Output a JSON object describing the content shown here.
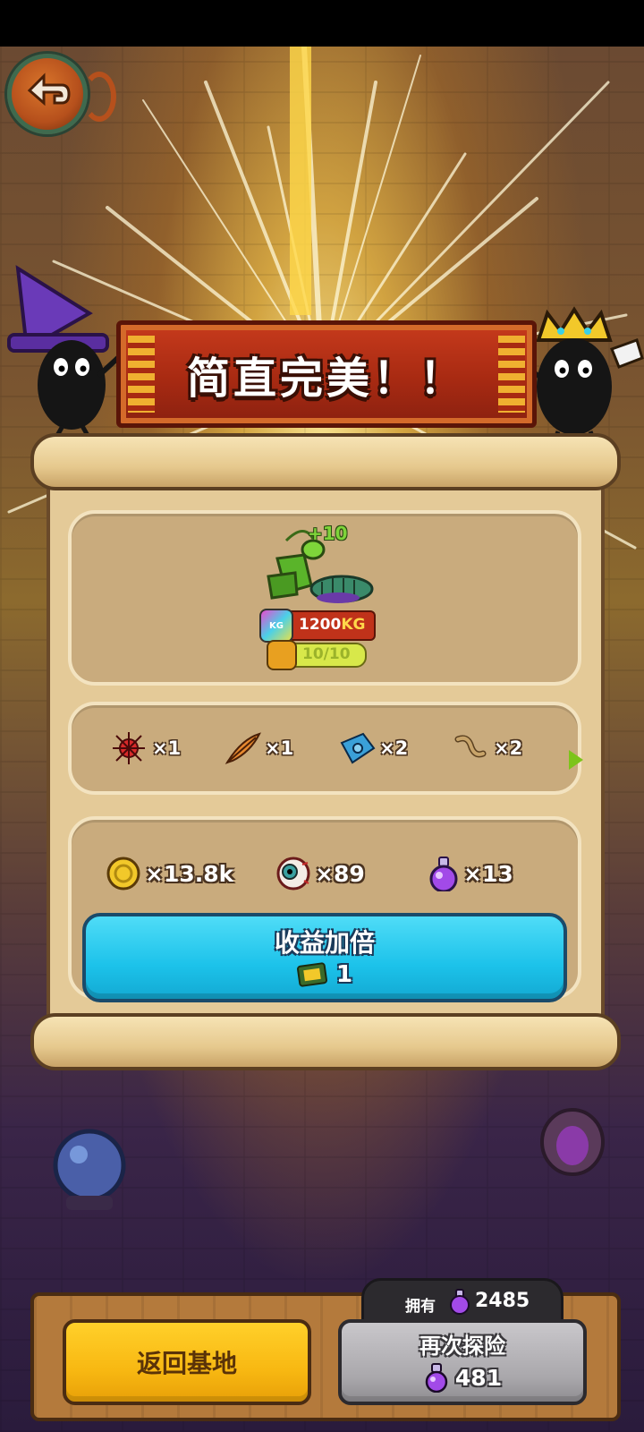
{
  "banner": {
    "title": "简直完美！！"
  },
  "monster": {
    "level_gain": "+10",
    "weight_value": "1200",
    "weight_unit": "KG",
    "kg_icon_text": "KG",
    "stamina": "10/10",
    "stamina_fraction": 1.0
  },
  "items": [
    {
      "icon": "red-spider-icon",
      "count": "×1"
    },
    {
      "icon": "feather-icon",
      "count": "×1"
    },
    {
      "icon": "blue-gear-chip-icon",
      "count": "×2"
    },
    {
      "icon": "worm-icon",
      "count": "×2"
    }
  ],
  "rewards": [
    {
      "icon": "gold-coin-icon",
      "count": "×13.8k"
    },
    {
      "icon": "eyeball-icon",
      "count": "×89"
    },
    {
      "icon": "purple-potion-icon",
      "count": "×13"
    }
  ],
  "double_button": {
    "label": "收益加倍",
    "cost": "1",
    "cost_icon": "ticket-icon"
  },
  "owned": {
    "label": "拥有",
    "value": "2485",
    "icon": "purple-potion-icon"
  },
  "return_button": {
    "label": "返回基地"
  },
  "explore_button": {
    "label": "再次探险",
    "cost": "481",
    "cost_icon": "purple-potion-icon"
  },
  "colors": {
    "banner": "#b02e14",
    "scroll": "#e4ca98",
    "panel": "#c9ab7d",
    "double_button": "#1cc2ea",
    "return_button": "#f8b812",
    "explore_button": "#a9a7ab"
  }
}
